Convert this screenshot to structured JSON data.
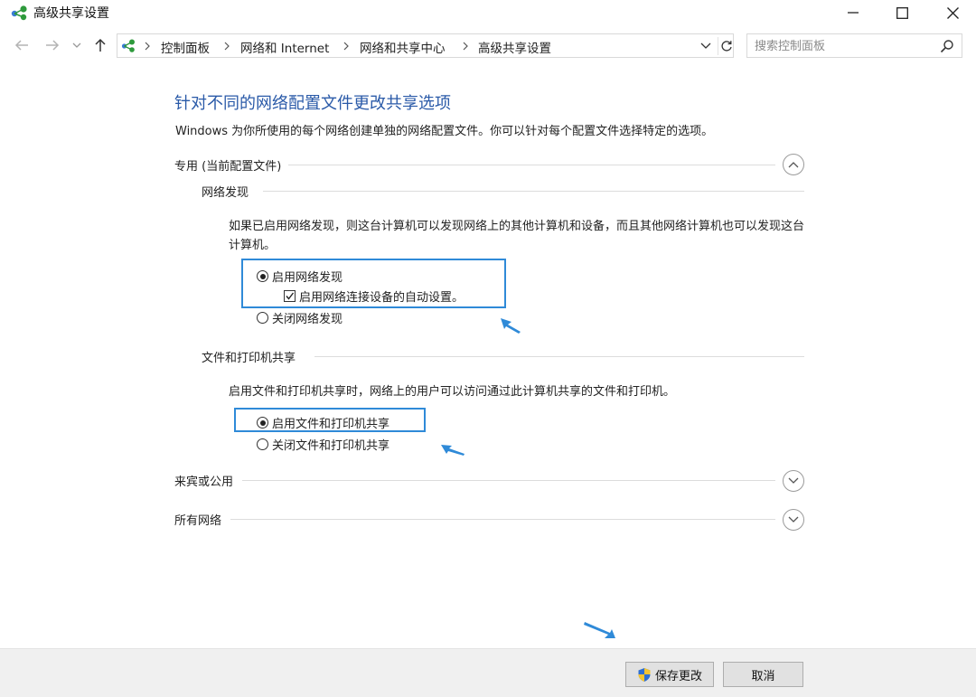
{
  "window": {
    "title": "高级共享设置",
    "icons": {
      "app": "network-sharing-icon",
      "minimize": "minimize-icon",
      "maximize": "maximize-icon",
      "close": "close-icon"
    }
  },
  "nav": {
    "back": "back-arrow-icon",
    "forward": "forward-arrow-icon",
    "recent": "chevron-down-icon",
    "up": "up-arrow-icon",
    "breadcrumb": [
      "控制面板",
      "网络和 Internet",
      "网络和共享中心",
      "高级共享设置"
    ],
    "search_placeholder": "搜索控制面板"
  },
  "page": {
    "heading": "针对不同的网络配置文件更改共享选项",
    "description": "Windows 为你所使用的每个网络创建单独的网络配置文件。你可以针对每个配置文件选择特定的选项。"
  },
  "profiles": {
    "private": {
      "label": "专用 (当前配置文件)",
      "expanded": true,
      "network_discovery": {
        "title": "网络发现",
        "text": "如果已启用网络发现，则这台计算机可以发现网络上的其他计算机和设备，而且其他网络计算机也可以发现这台计算机。",
        "on_label": "启用网络发现",
        "auto_setup_label": "启用网络连接设备的自动设置。",
        "off_label": "关闭网络发现",
        "selected": "on",
        "auto_setup_checked": true
      },
      "file_printer_sharing": {
        "title": "文件和打印机共享",
        "text": "启用文件和打印机共享时，网络上的用户可以访问通过此计算机共享的文件和打印机。",
        "on_label": "启用文件和打印机共享",
        "off_label": "关闭文件和打印机共享",
        "selected": "on"
      }
    },
    "guest": {
      "label": "来宾或公用",
      "expanded": false
    },
    "all": {
      "label": "所有网络",
      "expanded": false
    }
  },
  "buttons": {
    "save": "保存更改",
    "cancel": "取消"
  },
  "colors": {
    "accent_heading": "#2a5aa8",
    "highlight_box": "#2f8ad8",
    "annotation_arrow": "#2f8ad8"
  }
}
